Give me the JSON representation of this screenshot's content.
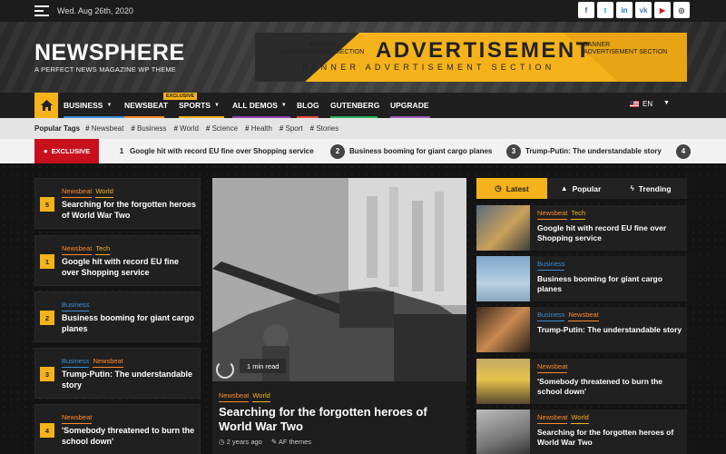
{
  "topbar": {
    "date": "Wed. Aug 26th, 2020",
    "socials": [
      {
        "icon": "facebook-icon",
        "glyph": "f",
        "color": "#3b5998"
      },
      {
        "icon": "twitter-icon",
        "glyph": "t",
        "color": "#1da1f2"
      },
      {
        "icon": "linkedin-icon",
        "glyph": "in",
        "color": "#0077b5"
      },
      {
        "icon": "vk-icon",
        "glyph": "vk",
        "color": "#4a76a8"
      },
      {
        "icon": "youtube-icon",
        "glyph": "▶",
        "color": "#cc181e"
      },
      {
        "icon": "instagram-icon",
        "glyph": "◎",
        "color": "#444444"
      }
    ]
  },
  "header": {
    "site_title": "NEWSPHERE",
    "tagline": "A PERFECT NEWS MAGAZINE WP THEME",
    "ad": {
      "small_left": "BANNER\nADVERTISEMENT SECTION",
      "main": "ADVERTISEMENT",
      "small_right": "BANNER\nADVERTISEMENT SECTION",
      "sub": "BANNER ADVERTISEMENT SECTION"
    }
  },
  "nav": {
    "items": [
      {
        "label": "BUSINESS",
        "has_caret": true,
        "color": "#3a8fd8"
      },
      {
        "label": "NEWSBEAT",
        "has_caret": false,
        "color": "#ff8a2a"
      },
      {
        "label": "SPORTS",
        "has_caret": true,
        "color": "#f5b21a"
      },
      {
        "label": "ALL DEMOS",
        "has_caret": true,
        "color": "#8e44ad"
      },
      {
        "label": "BLOG",
        "has_caret": false,
        "color": "#e74c3c"
      },
      {
        "label": "GUTENBERG",
        "has_caret": false,
        "color": "#27ae60"
      },
      {
        "label": "UPGRADE",
        "has_caret": false,
        "color": "#9b59b6"
      }
    ],
    "badge": "EXCLUSIVE",
    "language": "EN"
  },
  "popular_tags": {
    "label": "Popular Tags",
    "tags": [
      "Newsbeat",
      "Business",
      "World",
      "Science",
      "Health",
      "Sport",
      "Stories"
    ]
  },
  "ticker": {
    "label": "EXCLUSIVE",
    "items": [
      {
        "num": "1",
        "text": "Google hit with record EU fine over Shopping service"
      },
      {
        "num": "2",
        "text": "Business booming for giant cargo planes"
      },
      {
        "num": "3",
        "text": "Trump-Putin: The understandable story"
      },
      {
        "num": "4",
        "text": ""
      }
    ]
  },
  "left_list": [
    {
      "num": "5",
      "cats": [
        {
          "name": "Newsbeat",
          "c": "orange"
        },
        {
          "name": "World",
          "c": "yellow"
        }
      ],
      "title": "Searching for the forgotten heroes of World War Two"
    },
    {
      "num": "1",
      "cats": [
        {
          "name": "Newsbeat",
          "c": "orange"
        },
        {
          "name": "Tech",
          "c": "yellow"
        }
      ],
      "title": "Google hit with record EU fine over Shopping service"
    },
    {
      "num": "2",
      "cats": [
        {
          "name": "Business",
          "c": "blue"
        }
      ],
      "title": "Business booming for giant cargo planes"
    },
    {
      "num": "3",
      "cats": [
        {
          "name": "Business",
          "c": "blue"
        },
        {
          "name": "Newsbeat",
          "c": "orange"
        }
      ],
      "title": "Trump-Putin: The understandable story"
    },
    {
      "num": "4",
      "cats": [
        {
          "name": "Newsbeat",
          "c": "orange"
        }
      ],
      "title": "'Somebody threatened to burn the school down'"
    }
  ],
  "featured": {
    "read_time": "1 min read",
    "cats": [
      {
        "name": "Newsbeat",
        "c": "orange"
      },
      {
        "name": "World",
        "c": "yellow"
      }
    ],
    "title": "Searching for the forgotten heroes of World War Two",
    "time": "2 years ago",
    "author": "AF themes"
  },
  "right_tabs": [
    {
      "label": "Latest",
      "icon": "clock-icon",
      "glyph": "◷"
    },
    {
      "label": "Popular",
      "icon": "fire-icon",
      "glyph": "🔥"
    },
    {
      "label": "Trending",
      "icon": "bolt-icon",
      "glyph": "⚡"
    }
  ],
  "right_list": [
    {
      "cats": [
        {
          "name": "Newsbeat",
          "c": "orange"
        },
        {
          "name": "Tech",
          "c": "yellow"
        }
      ],
      "title": "Google hit with record EU fine over Shopping service",
      "thumb": "linear-gradient(135deg,#5a6b7c,#c9a15a 55%,#3d3d3d)"
    },
    {
      "cats": [
        {
          "name": "Business",
          "c": "blue"
        }
      ],
      "title": "Business booming for giant cargo planes",
      "thumb": "linear-gradient(180deg,#7ea6c9,#b9d0e3 60%,#8aa7bd)"
    },
    {
      "cats": [
        {
          "name": "Business",
          "c": "blue"
        },
        {
          "name": "Newsbeat",
          "c": "orange"
        }
      ],
      "title": "Trump-Putin: The understandable story",
      "thumb": "linear-gradient(135deg,#3a2a1e,#c98a52 50%,#2a1e16)"
    },
    {
      "cats": [
        {
          "name": "Newsbeat",
          "c": "orange"
        }
      ],
      "title": "'Somebody threatened to burn the school down'",
      "thumb": "linear-gradient(180deg,#c4a86a,#e7c44a 45%,#5a4a30)"
    },
    {
      "cats": [
        {
          "name": "Newsbeat",
          "c": "orange"
        },
        {
          "name": "World",
          "c": "yellow"
        }
      ],
      "title": "Searching for the forgotten heroes of World War Two",
      "thumb": "linear-gradient(160deg,#bbbbbb,#777777 60%,#333333)"
    }
  ]
}
